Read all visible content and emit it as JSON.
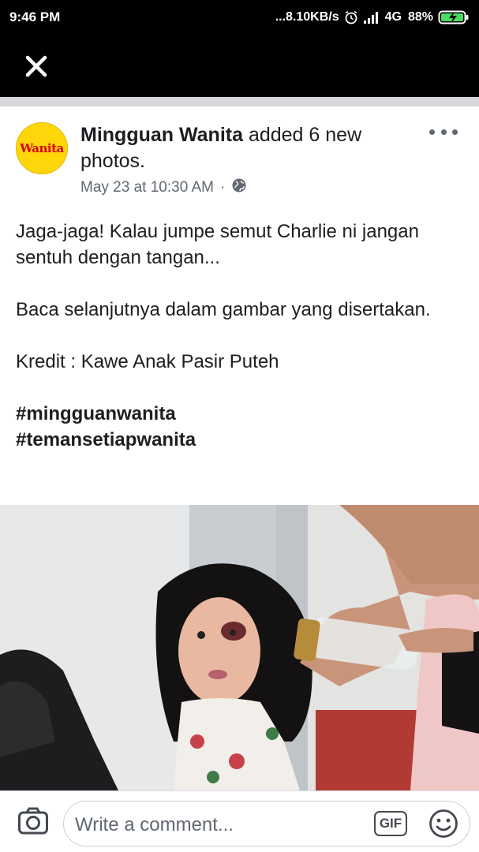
{
  "status_bar": {
    "time": "9:46 PM",
    "network_speed": "...8.10KB/s",
    "network_type": "4G",
    "battery_percent": "88%",
    "icons": [
      "alarm-icon",
      "signal-icon",
      "battery-charging-icon"
    ]
  },
  "nav": {
    "close_icon": "close-icon"
  },
  "post": {
    "author": "Mingguan Wanita",
    "action": " added 6 new photos.",
    "avatar_text": "Wanita",
    "timestamp": "May 23 at 10:30 AM",
    "separator": "·",
    "privacy_icon": "globe-icon",
    "more_icon": "more-options-icon",
    "body": {
      "para1": "Jaga-jaga! Kalau jumpe semut Charlie ni jangan sentuh dengan tangan...",
      "para2": "Baca selanjutnya dalam gambar yang disertakan.",
      "para3": "Kredit : Kawe Anak Pasir Puteh",
      "hashtags": [
        "#mingguanwanita",
        "#temansetiapwanita"
      ]
    }
  },
  "comment_bar": {
    "placeholder": "Write a comment...",
    "gif_label": "GIF",
    "camera_icon": "camera-icon",
    "emoji_icon": "emoji-icon"
  },
  "colors": {
    "text_primary": "#1c1e21",
    "text_secondary": "#606770",
    "avatar_bg": "#ffd60a",
    "brand_red": "#d6001c"
  }
}
